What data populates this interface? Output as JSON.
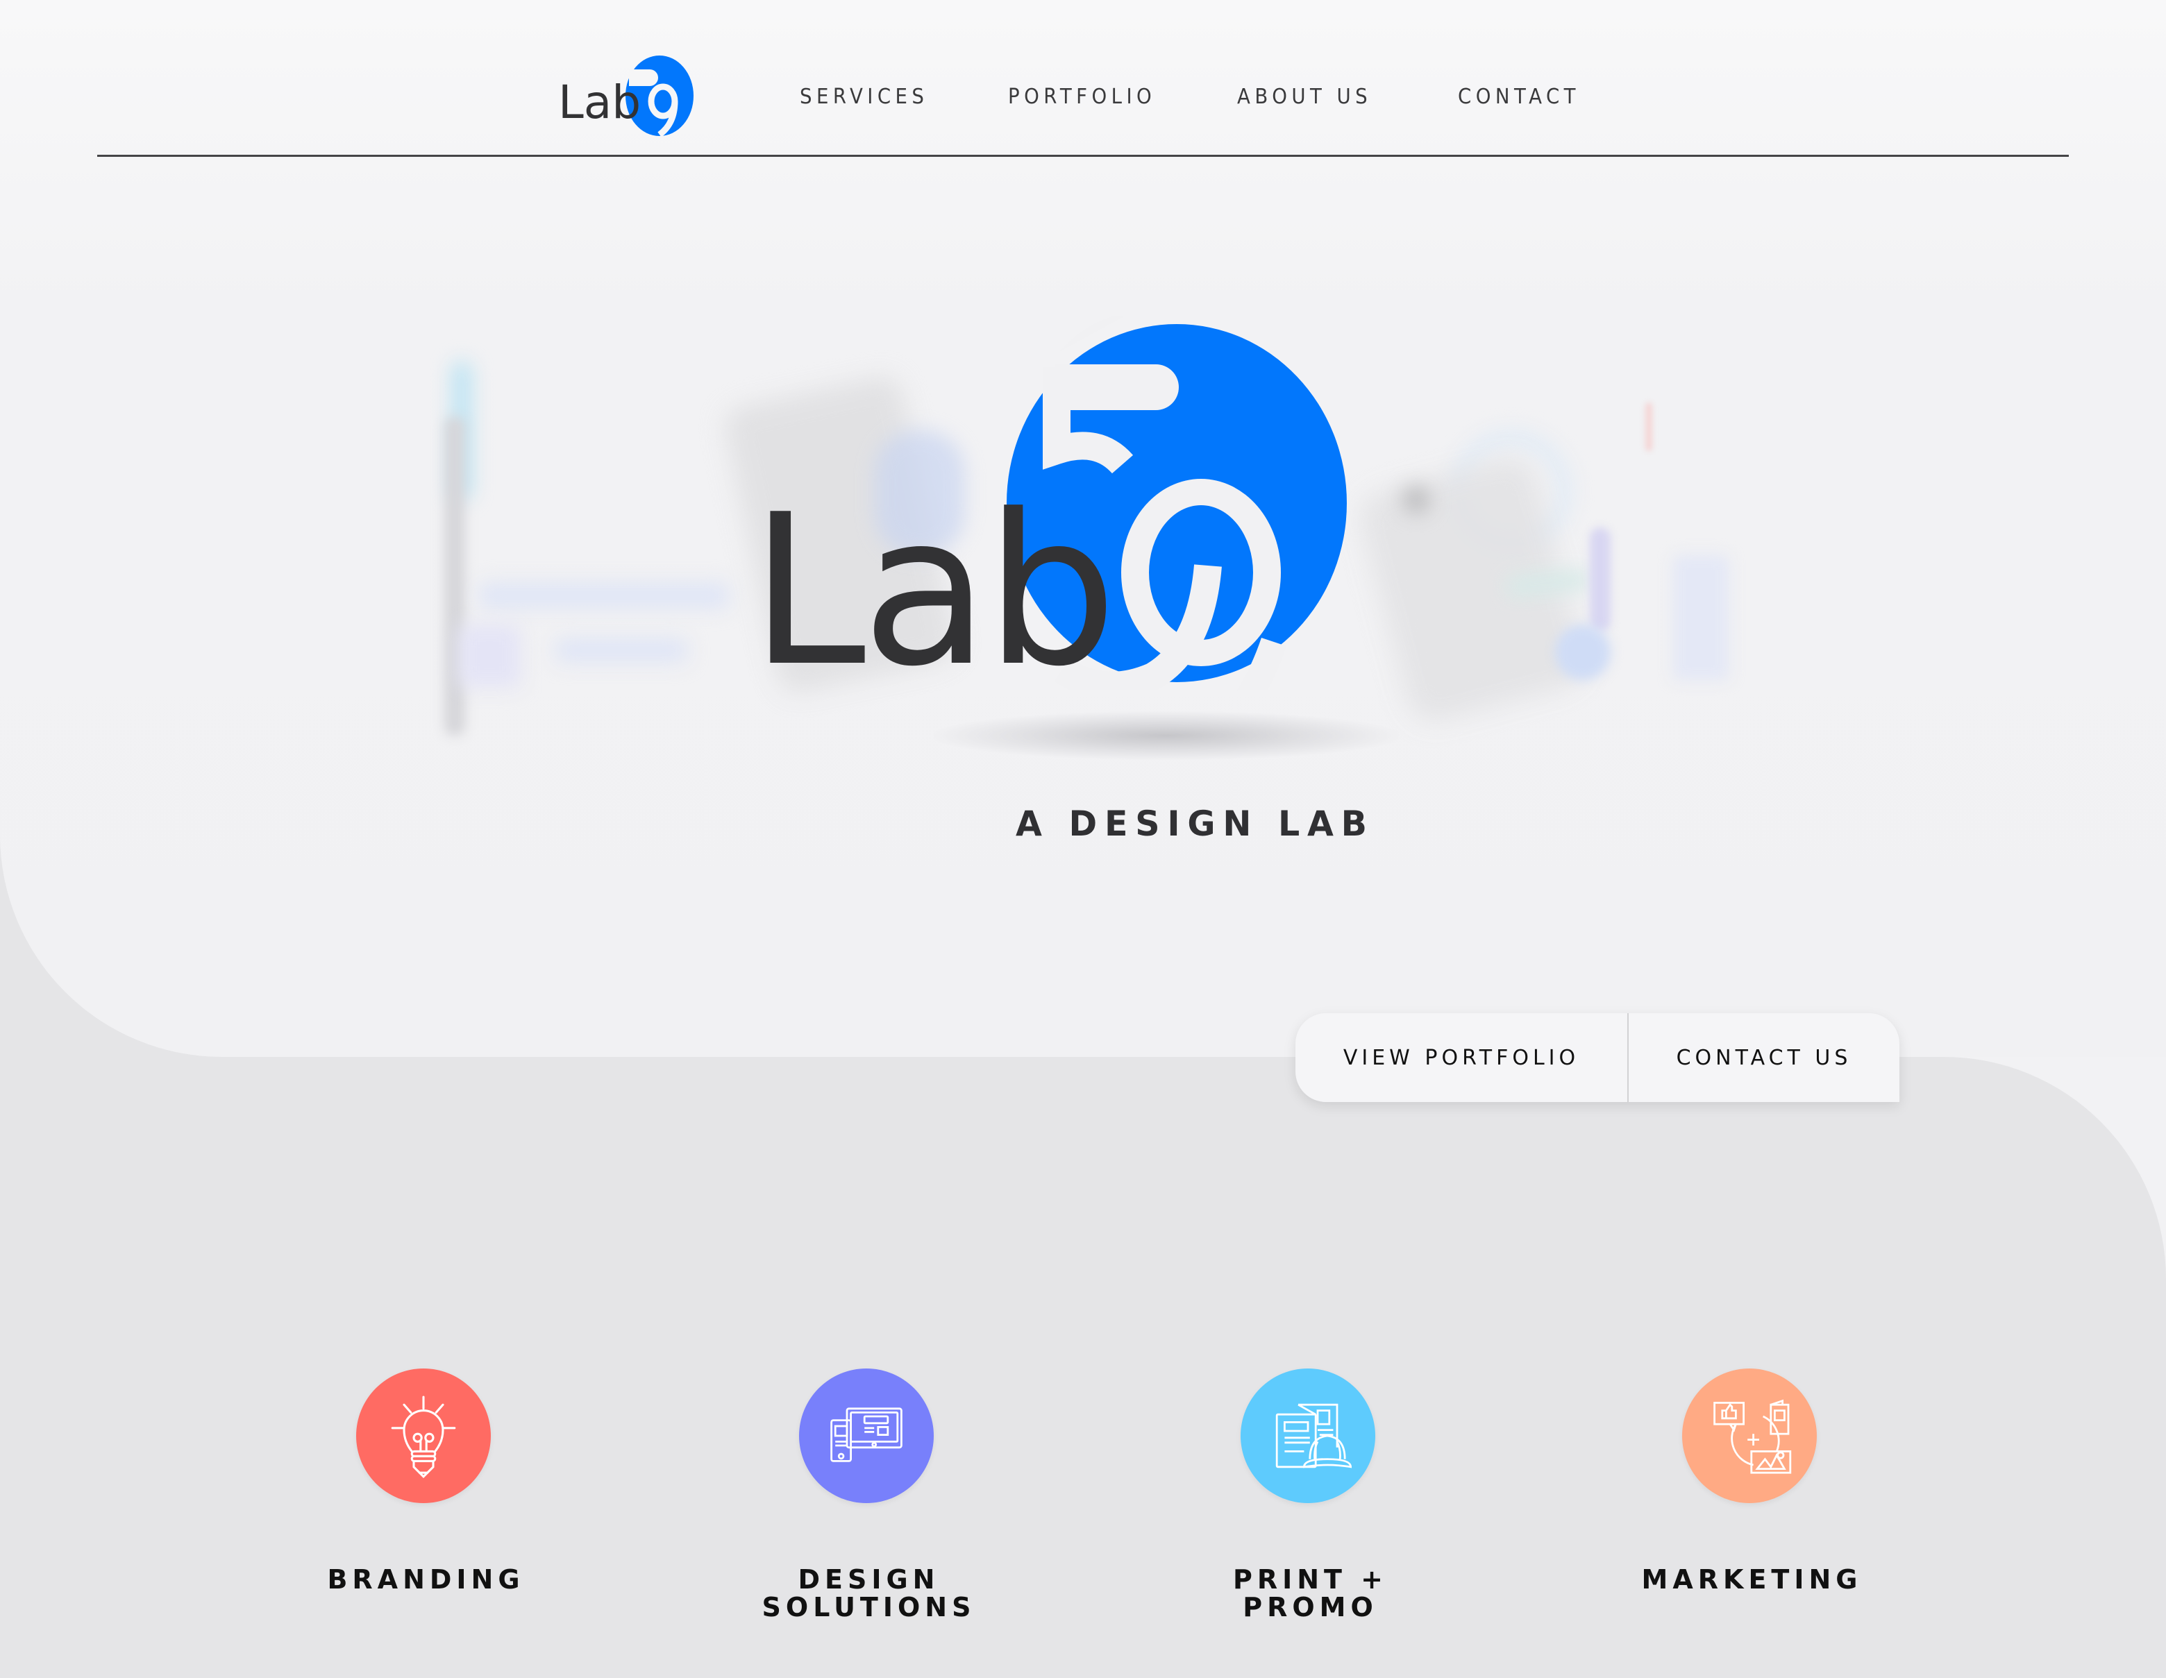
{
  "brand": {
    "name_text": "Lab",
    "name_digits": "59",
    "accent_color": "#0277fc",
    "text_color": "#323234",
    "tagline": "A DESIGN LAB"
  },
  "nav": {
    "items": [
      {
        "label": "SERVICES"
      },
      {
        "label": "PORTFOLIO"
      },
      {
        "label": "ABOUT US"
      },
      {
        "label": "CONTACT"
      }
    ]
  },
  "hero": {
    "buttons": {
      "view_portfolio": "VIEW PORTFOLIO",
      "contact_us": "CONTACT US"
    }
  },
  "services": [
    {
      "label": "BRANDING",
      "icon": "lightbulb-pencil-icon",
      "color": "#ff6b63"
    },
    {
      "label": "DESIGN SOLUTIONS",
      "label_line1": "DESIGN",
      "label_line2": "SOLUTIONS",
      "icon": "devices-icon",
      "color": "#7880fb"
    },
    {
      "label": "PRINT + PROMO",
      "icon": "print-cap-icon",
      "color": "#5ecbfd"
    },
    {
      "label": "MARKETING",
      "icon": "marketing-cycle-icon",
      "color": "#ffaa84"
    }
  ]
}
